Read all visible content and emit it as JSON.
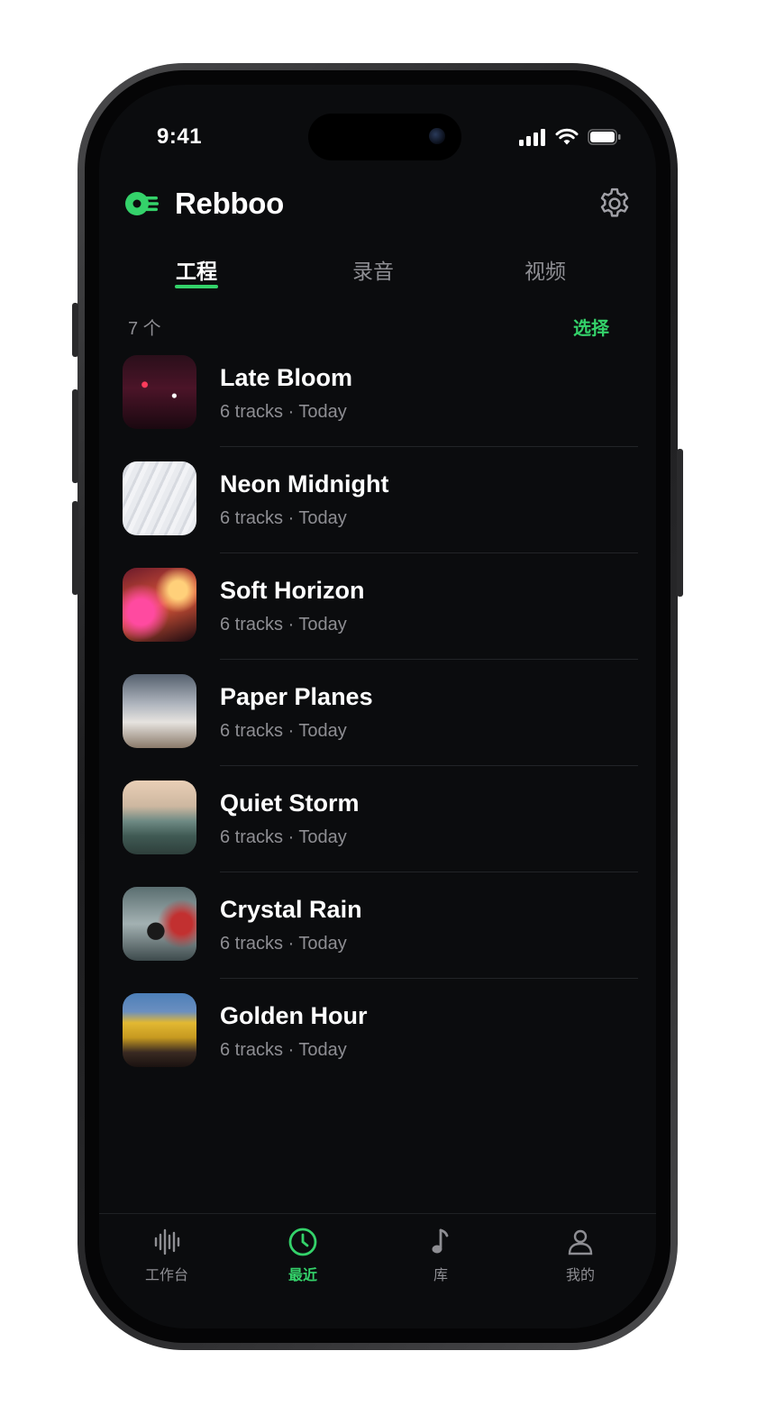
{
  "status_bar": {
    "time": "9:41"
  },
  "app": {
    "title": "Rebboo"
  },
  "tabs": [
    {
      "label": "工程",
      "active": true
    },
    {
      "label": "录音",
      "active": false
    },
    {
      "label": "视频",
      "active": false
    }
  ],
  "list_header": {
    "count": "7 个",
    "select_label": "选择"
  },
  "projects": [
    {
      "title": "Late Bloom",
      "subtitle": "6 tracks · Today"
    },
    {
      "title": "Neon Midnight",
      "subtitle": "6 tracks · Today"
    },
    {
      "title": "Soft Horizon",
      "subtitle": "6 tracks · Today"
    },
    {
      "title": "Paper Planes",
      "subtitle": "6 tracks · Today"
    },
    {
      "title": "Quiet Storm",
      "subtitle": "6 tracks · Today"
    },
    {
      "title": "Crystal Rain",
      "subtitle": "6 tracks · Today"
    },
    {
      "title": "Golden Hour",
      "subtitle": "6 tracks · Today"
    }
  ],
  "tabbar": [
    {
      "label": "工作台",
      "icon": "waveform-icon",
      "active": false
    },
    {
      "label": "最近",
      "icon": "clock-icon",
      "active": true
    },
    {
      "label": "库",
      "icon": "music-note-icon",
      "active": false
    },
    {
      "label": "我的",
      "icon": "person-icon",
      "active": false
    }
  ],
  "colors": {
    "accent": "#34d26a",
    "background": "#0b0c0e",
    "muted": "#8e8e93"
  }
}
